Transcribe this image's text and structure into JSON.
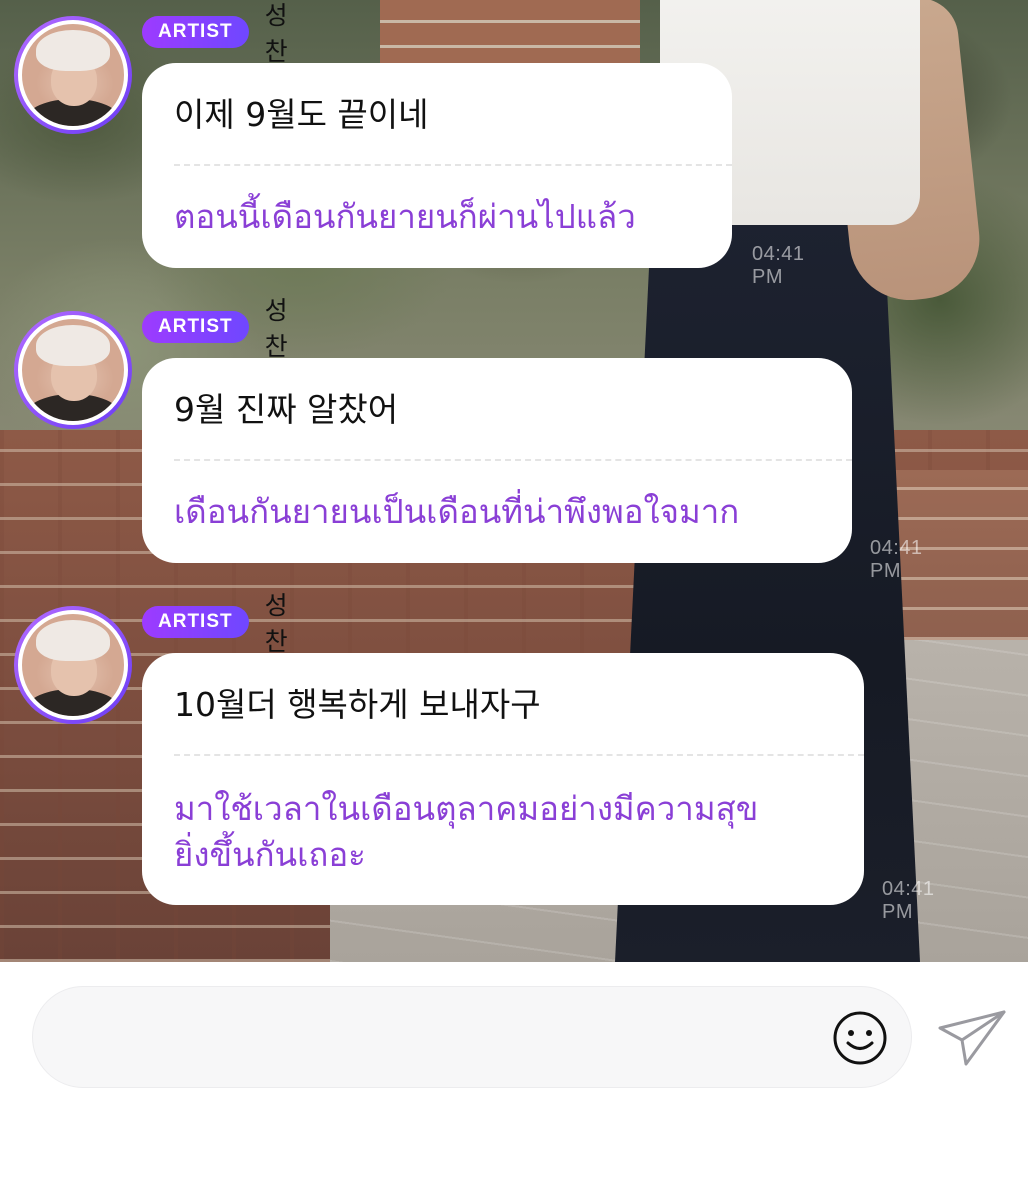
{
  "chat": {
    "messages": [
      {
        "badge": "ARTIST",
        "sender": "성찬",
        "original": "이제 9월도 끝이네",
        "translation": "ตอนนี้เดือนกันยายนก็ผ่านไปแล้ว",
        "time": "04:41 PM"
      },
      {
        "badge": "ARTIST",
        "sender": "성찬",
        "original": "9월 진짜 알찼어",
        "translation": "เดือนกันยายนเป็นเดือนที่น่าพึงพอใจมาก",
        "time": "04:41 PM"
      },
      {
        "badge": "ARTIST",
        "sender": "성찬",
        "original": "10월더 행복하게 보내자구",
        "translation_line1": "มาใช้เวลาในเดือนตุลาคมอย่างมีความสุข",
        "translation_line2": "ยิ่งขึ้นกันเถอะ",
        "time": "04:41 PM"
      }
    ]
  },
  "composer": {
    "placeholder": "",
    "value": "",
    "emoji_icon": "smiley-face-icon",
    "send_icon": "paper-plane-icon"
  },
  "colors": {
    "badge_gradient_start": "#9d3bff",
    "badge_gradient_end": "#6f47ff",
    "translation_text": "#8a3fd6",
    "avatar_ring": "#8b4cf7"
  }
}
